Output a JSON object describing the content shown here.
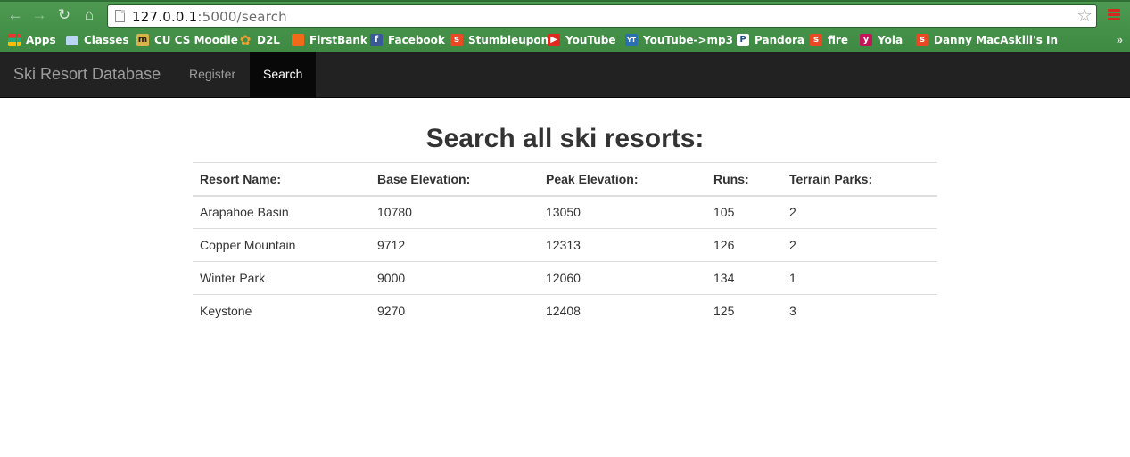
{
  "browser": {
    "url_host": "127.0.0.1",
    "url_path": ":5000/search",
    "bookmarks": [
      {
        "label": "Apps",
        "icon": "apps-grid-icon"
      },
      {
        "label": "Classes",
        "icon": "folder-icon"
      },
      {
        "label": "CU CS Moodle",
        "icon": "moodle-icon"
      },
      {
        "label": "D2L",
        "icon": "d2l-icon"
      },
      {
        "label": "FirstBank",
        "icon": "firstbank-icon"
      },
      {
        "label": "Facebook",
        "icon": "facebook-icon"
      },
      {
        "label": "Stumbleupon",
        "icon": "stumbleupon-icon"
      },
      {
        "label": "YouTube",
        "icon": "youtube-icon"
      },
      {
        "label": "YouTube->mp3",
        "icon": "youtube-mp3-icon"
      },
      {
        "label": "Pandora",
        "icon": "pandora-icon"
      },
      {
        "label": "fire",
        "icon": "stumbleupon-icon"
      },
      {
        "label": "Yola",
        "icon": "yola-icon"
      },
      {
        "label": "Danny MacAskill's In",
        "icon": "stumbleupon-icon"
      }
    ],
    "more_label": "»"
  },
  "navbar": {
    "brand": "Ski Resort Database",
    "items": [
      {
        "label": "Register",
        "active": false
      },
      {
        "label": "Search",
        "active": true
      }
    ]
  },
  "main": {
    "title": "Search all ski resorts:",
    "columns": [
      "Resort Name:",
      "Base Elevation:",
      "Peak Elevation:",
      "Runs:",
      "Terrain Parks:"
    ],
    "rows": [
      [
        "Arapahoe Basin",
        "10780",
        "13050",
        "105",
        "2"
      ],
      [
        "Copper Mountain",
        "9712",
        "12313",
        "126",
        "2"
      ],
      [
        "Winter Park",
        "9000",
        "12060",
        "134",
        "1"
      ],
      [
        "Keystone",
        "9270",
        "12408",
        "125",
        "3"
      ]
    ]
  },
  "colors": {
    "chrome_green": "#3e8a43",
    "navbar_bg": "#222222",
    "navbar_active_bg": "#080808",
    "text": "#333333"
  }
}
